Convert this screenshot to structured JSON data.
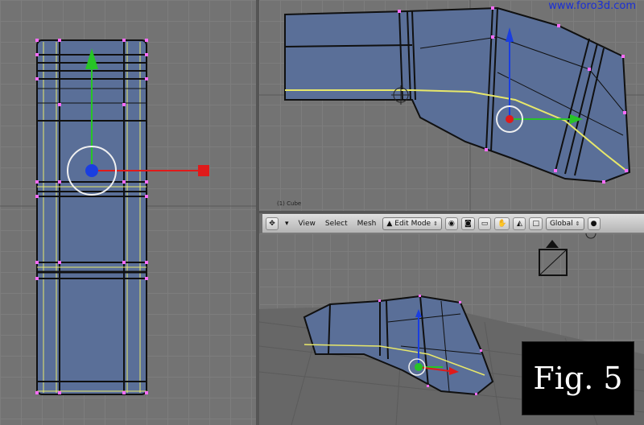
{
  "watermark": "www.foro3d.com",
  "figure_label": "Fig. 5",
  "top_view": {
    "label": "(1) Cube"
  },
  "header": {
    "menus": [
      "View",
      "Select",
      "Mesh"
    ],
    "mode_select": "Edit Mode",
    "orientation_select": "Global"
  },
  "icons": {
    "view_type": "cross-arrows-icon",
    "mode": "edit-mode-icon",
    "vertex_select": "vertex-select-icon",
    "edge_select": "edge-select-icon",
    "face_select": "face-select-icon",
    "occlude": "occlude-geometry-icon",
    "pivot": "pivot-point-icon",
    "manipulator": "manipulator-icon",
    "layers": "layers-icon"
  },
  "colors": {
    "mesh_fill": "#5a6f98",
    "mesh_edge": "#101010",
    "selected_edge": "#e8e86a",
    "vertex": "#ff6cff",
    "axis_x": "#e01a1a",
    "axis_y": "#27c427",
    "axis_z": "#1a3ee0",
    "watermark": "#1a2fd6"
  }
}
